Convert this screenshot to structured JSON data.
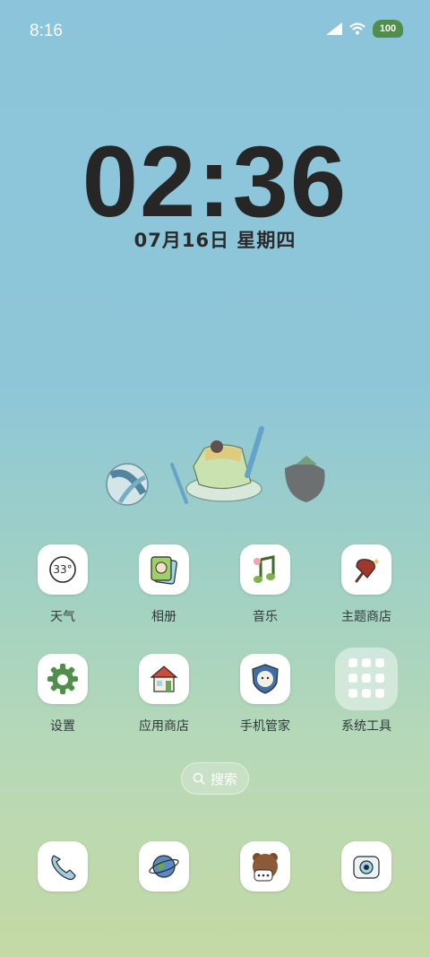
{
  "status_bar": {
    "time": "8:16",
    "battery": "100"
  },
  "lock": {
    "clock": "02:36",
    "date": "07月16日 星期四"
  },
  "apps_row1": [
    {
      "label": "天气",
      "icon": "weather-icon",
      "icon_text": "33°"
    },
    {
      "label": "相册",
      "icon": "gallery-icon"
    },
    {
      "label": "音乐",
      "icon": "music-icon"
    },
    {
      "label": "主题商店",
      "icon": "theme-store-icon"
    }
  ],
  "apps_row2": [
    {
      "label": "设置",
      "icon": "settings-gear-icon"
    },
    {
      "label": "应用商店",
      "icon": "app-store-icon"
    },
    {
      "label": "手机管家",
      "icon": "phone-manager-icon"
    },
    {
      "label": "系统工具",
      "icon": "system-tools-folder-icon"
    }
  ],
  "search": {
    "label": "搜索"
  },
  "dock": [
    {
      "icon": "phone-icon"
    },
    {
      "icon": "browser-planet-icon"
    },
    {
      "icon": "messages-bear-icon"
    },
    {
      "icon": "camera-icon"
    }
  ],
  "colors": {
    "accent_green": "#4f8f4a",
    "icon_bg": "#ffffff"
  }
}
